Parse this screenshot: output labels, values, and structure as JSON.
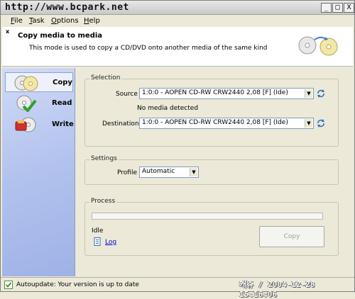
{
  "watermark": "http://www.bcpark.net",
  "titlebar": {
    "min": "_",
    "max": "□",
    "close": "X"
  },
  "menu": [
    {
      "key": "F",
      "rest": "ile"
    },
    {
      "key": "T",
      "rest": "ask"
    },
    {
      "key": "O",
      "rest": "ptions"
    },
    {
      "key": "H",
      "rest": "elp"
    }
  ],
  "header": {
    "close_glyph": "x",
    "title": "Copy media to media",
    "description": "This mode is used to copy a CD/DVD onto another media of the same kind",
    "icon": "disc-copy-icon"
  },
  "sidebar": {
    "items": [
      {
        "label": "Copy",
        "icon": "copy-discs-icon",
        "active": true
      },
      {
        "label": "Read",
        "icon": "read-disc-icon",
        "active": false
      },
      {
        "label": "Write",
        "icon": "write-disc-icon",
        "active": false
      }
    ]
  },
  "selection": {
    "title": "Selection",
    "source_label": "Source",
    "source_value": "1:0:0 - AOPEN CD-RW CRW2440 2,08 [F] (Ide)",
    "status": "No media detected",
    "destination_label": "Destination",
    "destination_value": "1:0:0 - AOPEN CD-RW CRW2440 2,08 [F] (Ide)"
  },
  "settings": {
    "title": "Settings",
    "profile_label": "Profile",
    "profile_value": "Automatic"
  },
  "process": {
    "title": "Process",
    "progress": 0,
    "state": "Idle",
    "log_label": "Log",
    "copy_label": "Copy"
  },
  "statusbar": {
    "text": "Autoupdate: Your version is up to date",
    "icon": "update-check-icon"
  },
  "stamp": "캐쥬 / 2004-12-28 15:16:06",
  "colors": {
    "sidebar": "#b2c2ee",
    "link": "#0000cc",
    "window": "#ece9d8"
  }
}
